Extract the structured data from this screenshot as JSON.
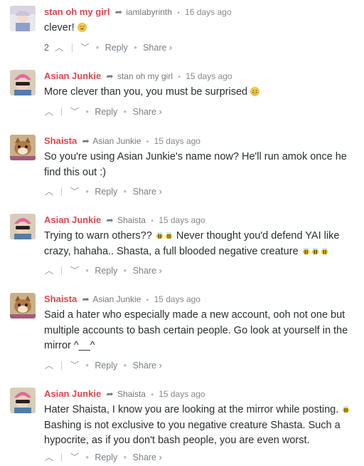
{
  "comments": [
    {
      "author": "stan oh my girl",
      "parent": "iamlabyrinth",
      "time": "16 days ago",
      "text": "clever! ",
      "emoji_after": [
        "smile-sweat"
      ],
      "vote_count": "2",
      "avatar": "girl-hat-icon",
      "actions": {
        "reply": "Reply",
        "share": "Share ›"
      }
    },
    {
      "author": "Asian Junkie",
      "parent": "stan oh my girl",
      "time": "15 days ago",
      "text": "More clever than you, you must be surprised ",
      "emoji_after": [
        "grin"
      ],
      "vote_count": "",
      "avatar": "pink-beanie-icon",
      "actions": {
        "reply": "Reply",
        "share": "Share ›"
      }
    },
    {
      "author": "Shaista",
      "parent": "Asian Junkie",
      "time": "15 days ago",
      "text": "So you're using Asian Junkie's name now? He'll run amok once he find this out :)",
      "vote_count": "",
      "avatar": "cat-icon",
      "actions": {
        "reply": "Reply",
        "share": "Share ›"
      }
    },
    {
      "author": "Asian Junkie",
      "parent": "Shaista",
      "time": "15 days ago",
      "text_parts": [
        "Trying to warn others?? ",
        " Never thought you'd defend YAI like crazy, hahaha.. Shasta, a full blooded negative creature "
      ],
      "vote_count": "",
      "avatar": "pink-beanie-icon",
      "actions": {
        "reply": "Reply",
        "share": "Share ›"
      }
    },
    {
      "author": "Shaista",
      "parent": "Asian Junkie",
      "time": "15 days ago",
      "text": "Said a hater who especially made a new account, ooh not one but multiple accounts to bash certain people. Go look at yourself in the mirror ^__^",
      "vote_count": "",
      "avatar": "cat-icon",
      "actions": {
        "reply": "Reply",
        "share": "Share ›"
      }
    },
    {
      "author": "Asian Junkie",
      "parent": "Shaista",
      "time": "15 days ago",
      "text_parts": [
        "Hater Shaista, I know you are looking at the mirror while posting. ",
        " Bashing is not exclusive to you negative creature Shasta. Such a hypocrite, as if you don't bash people, you are even worst."
      ],
      "vote_count": "",
      "avatar": "pink-beanie-icon",
      "actions": {
        "reply": "Reply",
        "share": "Share ›"
      }
    }
  ],
  "colors": {
    "author": "#e0464d",
    "meta": "#777777",
    "text": "#2a2e2e"
  }
}
